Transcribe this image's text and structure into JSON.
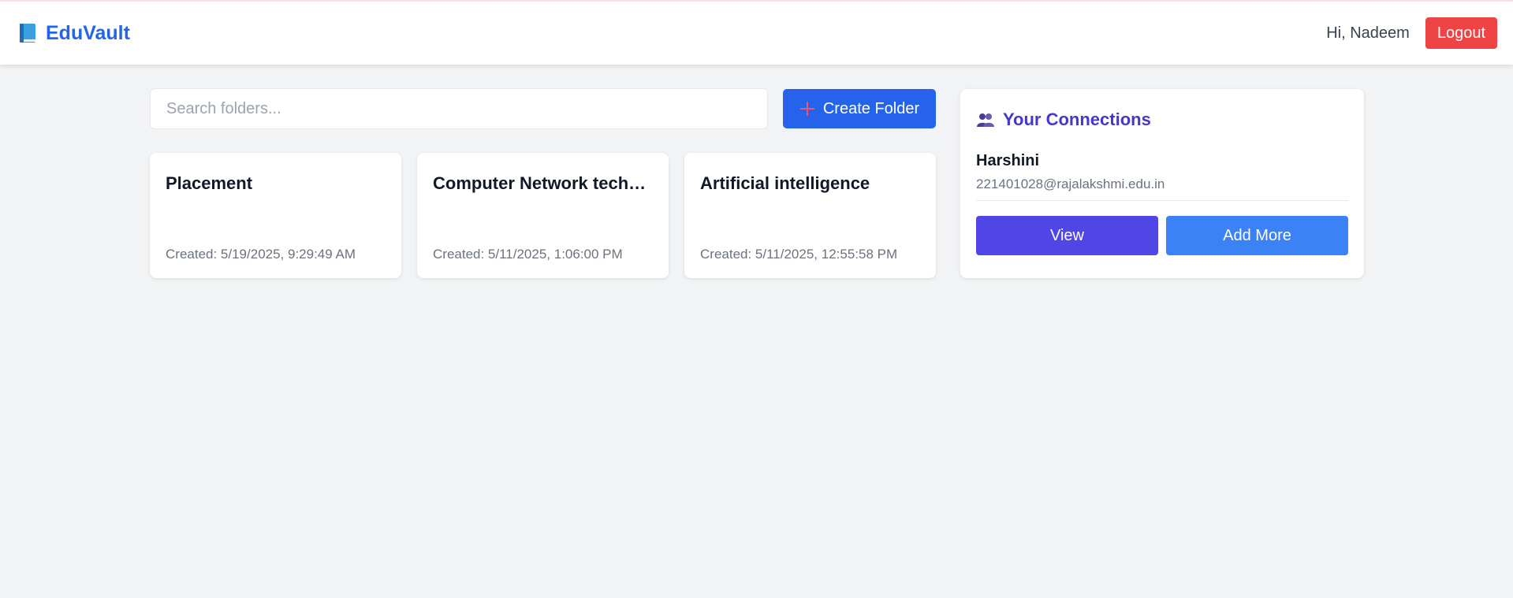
{
  "header": {
    "brand_name": "EduVault",
    "brand_icon": "book-icon",
    "greeting": "Hi, Nadeem",
    "logout_label": "Logout"
  },
  "toolbar": {
    "search_placeholder": "Search folders...",
    "create_label": "Create Folder",
    "create_icon": "plus-icon"
  },
  "folders": [
    {
      "name": "Computer Network techn...",
      "created": "Created: 5/11/2025, 1:06:00 PM"
    },
    {
      "name": "Placement",
      "created": "Created: 5/19/2025, 9:29:49 AM"
    },
    {
      "name": "Artificial intelligence",
      "created": "Created: 5/11/2025, 12:55:58 PM"
    }
  ],
  "connections": {
    "title": "Your Connections",
    "icon": "people-icon",
    "name": "Harshini",
    "email": "221401028@rajalakshmi.edu.in",
    "view_label": "View",
    "add_label": "Add More"
  },
  "colors": {
    "brand": "#2563eb",
    "logout": "#ef4444",
    "view": "#4f46e5",
    "add_more": "#3b82f6",
    "connections_title": "#4338ca"
  }
}
